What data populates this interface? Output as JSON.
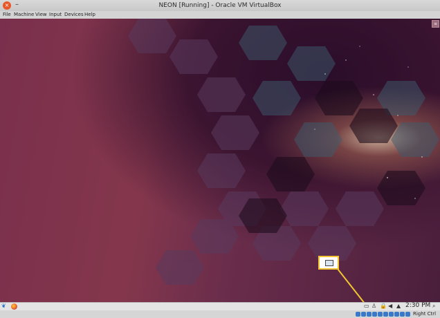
{
  "window": {
    "title": "NEON [Running] - Oracle VM VirtualBox",
    "close_glyph": "×",
    "minimize_glyph": "–"
  },
  "menu": [
    "File",
    "Machine",
    "View",
    "Input",
    "Devices",
    "Help"
  ],
  "taskbar": {
    "clock": "2:30 PM",
    "launcher_glyph": "❦",
    "tray_glyphs": [
      "▭",
      "♙",
      "🔒",
      "◀",
      "▲"
    ],
    "corner_glyph": "⌕"
  },
  "statusbar": {
    "host_key": "Right Ctrl"
  },
  "colors": {
    "callout": "#f2c531"
  }
}
